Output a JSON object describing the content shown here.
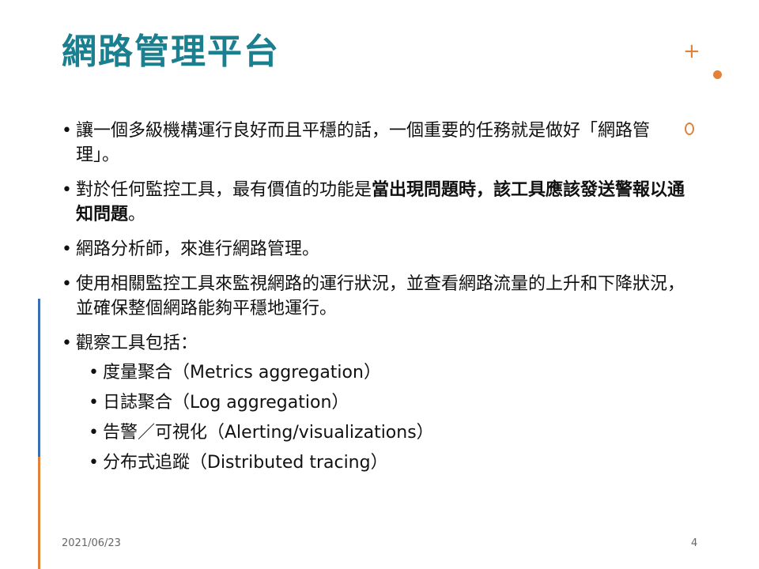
{
  "title": "網路管理平台",
  "bullets": [
    {
      "text": "讓一個多級機構運行良好而且平穩的話，一個重要的任務就是做好「網路管理」。"
    },
    {
      "text_normal": "對於任何監控工具，最有價值的功能是",
      "text_bold": "當出現問題時，該工具應該發送警報以通知問題",
      "text_tail": "。"
    },
    {
      "text": "網路分析師，來進行網路管理。"
    },
    {
      "text": "使用相關監控工具來監視網路的運行狀況，並查看網路流量的上升和下降狀況，並確保整個網路能夠平穩地運行。"
    },
    {
      "text": "觀察工具包括："
    }
  ],
  "sub_bullets": [
    "度量聚合（Metrics aggregation）",
    "日誌聚合（Log aggregation）",
    "告警／可視化（Alerting/visualizations）",
    "分布式追蹤（Distributed tracing）"
  ],
  "footer": {
    "date": "2021/06/23",
    "page_number": "4"
  },
  "colors": {
    "title": "#1a7f8f",
    "accent_orange": "#e0823a",
    "accent_blue": "#3b6fb5"
  }
}
